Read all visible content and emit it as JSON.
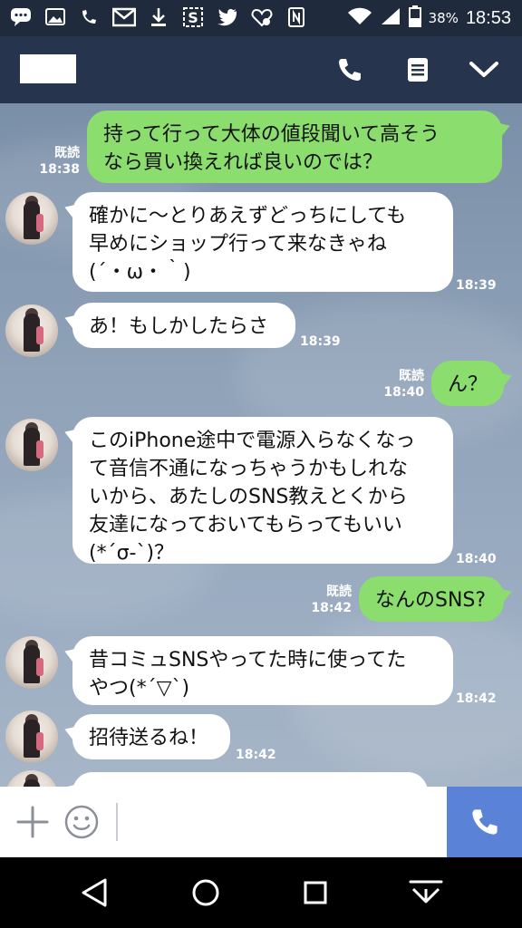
{
  "status_bar": {
    "battery": "38%",
    "time": "18:53",
    "left_icons": [
      "messages-icon",
      "photo-icon",
      "voip-icon",
      "gmail-icon",
      "download-icon",
      "s-icon",
      "twitter-icon",
      "heart-icon",
      "nfc-icon"
    ],
    "right_icons": [
      "wifi-icon",
      "signal-icon",
      "battery-icon"
    ]
  },
  "header": {
    "contact_name": "",
    "icons": [
      "phone-icon",
      "menu-icon",
      "chevron-down-icon"
    ]
  },
  "messages": [
    {
      "dir": "out",
      "text": "持って行って大体の値段聞いて高そう\nなら買い換えれば良いのでは？",
      "read": "既読",
      "time": "18:38"
    },
    {
      "dir": "in",
      "text": "確かに〜とりあえずどっちにしても\n早めにショップ行って来なきゃね\n(´・ω・｀)",
      "time": "18:39"
    },
    {
      "dir": "in",
      "text": "あ！もしかしたらさ",
      "time": "18:39"
    },
    {
      "dir": "out",
      "text": "ん？",
      "read": "既読",
      "time": "18:40"
    },
    {
      "dir": "in",
      "text": "このiPhone途中で電源入らなくなっ\nて音信不通になっちゃうかもしれな\nいから、あたしのSNS教えとくから\n友達になっておいてもらってもいい\n(*´σ-`)？",
      "time": "18:40"
    },
    {
      "dir": "out",
      "text": "なんのSNS?",
      "read": "既読",
      "time": "18:42"
    },
    {
      "dir": "in",
      "text": "昔コミュSNSやってた時に使ってた\nやつ(*´▽`)",
      "time": "18:42"
    },
    {
      "dir": "in",
      "text": "招待送るね！",
      "time": "18:42"
    },
    {
      "dir": "in",
      "text": "",
      "time": ""
    }
  ],
  "input_bar": {
    "placeholder": "",
    "icons": [
      "plus-icon",
      "emoji-icon",
      "call-icon"
    ]
  },
  "nav_bar": {
    "icons": [
      "back-icon",
      "home-icon",
      "recents-icon",
      "notification-pulldown-icon"
    ]
  },
  "colors": {
    "header_bg": "#26344d",
    "statusbar_bg": "#1f2a3c",
    "out_bubble": "#8bde6e",
    "in_bubble": "#ffffff",
    "call_button": "#5a82d6"
  }
}
